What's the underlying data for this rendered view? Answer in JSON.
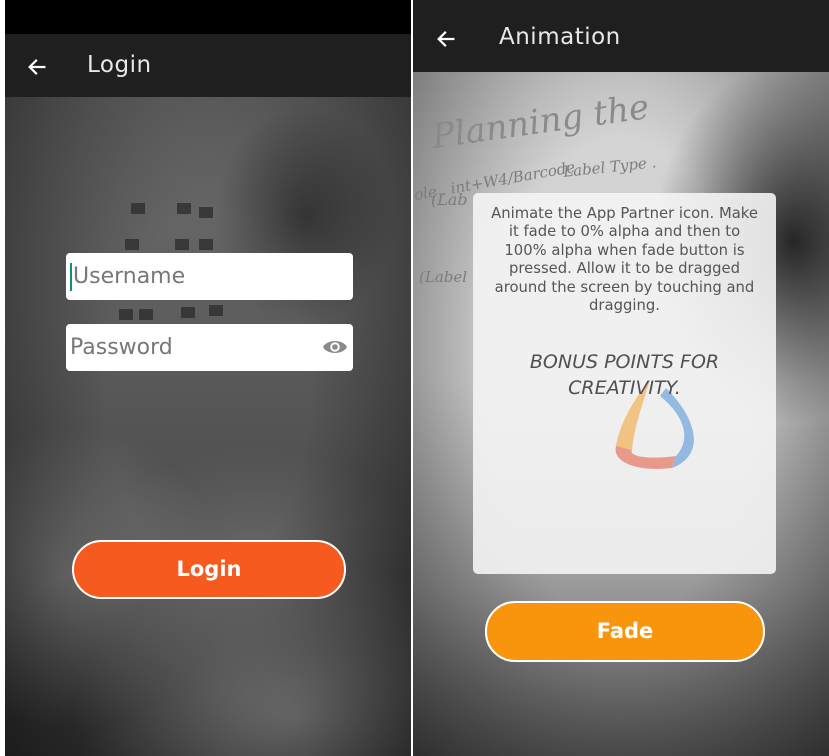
{
  "login_screen": {
    "title": "Login",
    "username_placeholder": "Username",
    "password_placeholder": "Password",
    "login_button": "Login",
    "icons": {
      "back": "arrow-left-icon",
      "password_toggle": "eye-icon"
    },
    "colors": {
      "login_button": "#f65a1e",
      "appbar": "#1f1f1f"
    }
  },
  "animation_screen": {
    "title": "Animation",
    "card_text": "Animate the App Partner icon. Make it fade to 0% alpha and then to 100% alpha when fade button is pressed. Allow it to be dragged around the screen by touching and dragging.",
    "card_bonus": "BONUS POINTS FOR CREATIVITY.",
    "fade_button": "Fade",
    "icons": {
      "back": "arrow-left-icon",
      "logo": "app-partner-logo-icon"
    },
    "colors": {
      "fade_button": "#f8950c",
      "logo_orange": "#f4a12c",
      "logo_red": "#e5533d",
      "logo_blue": "#4a8fd8"
    }
  }
}
